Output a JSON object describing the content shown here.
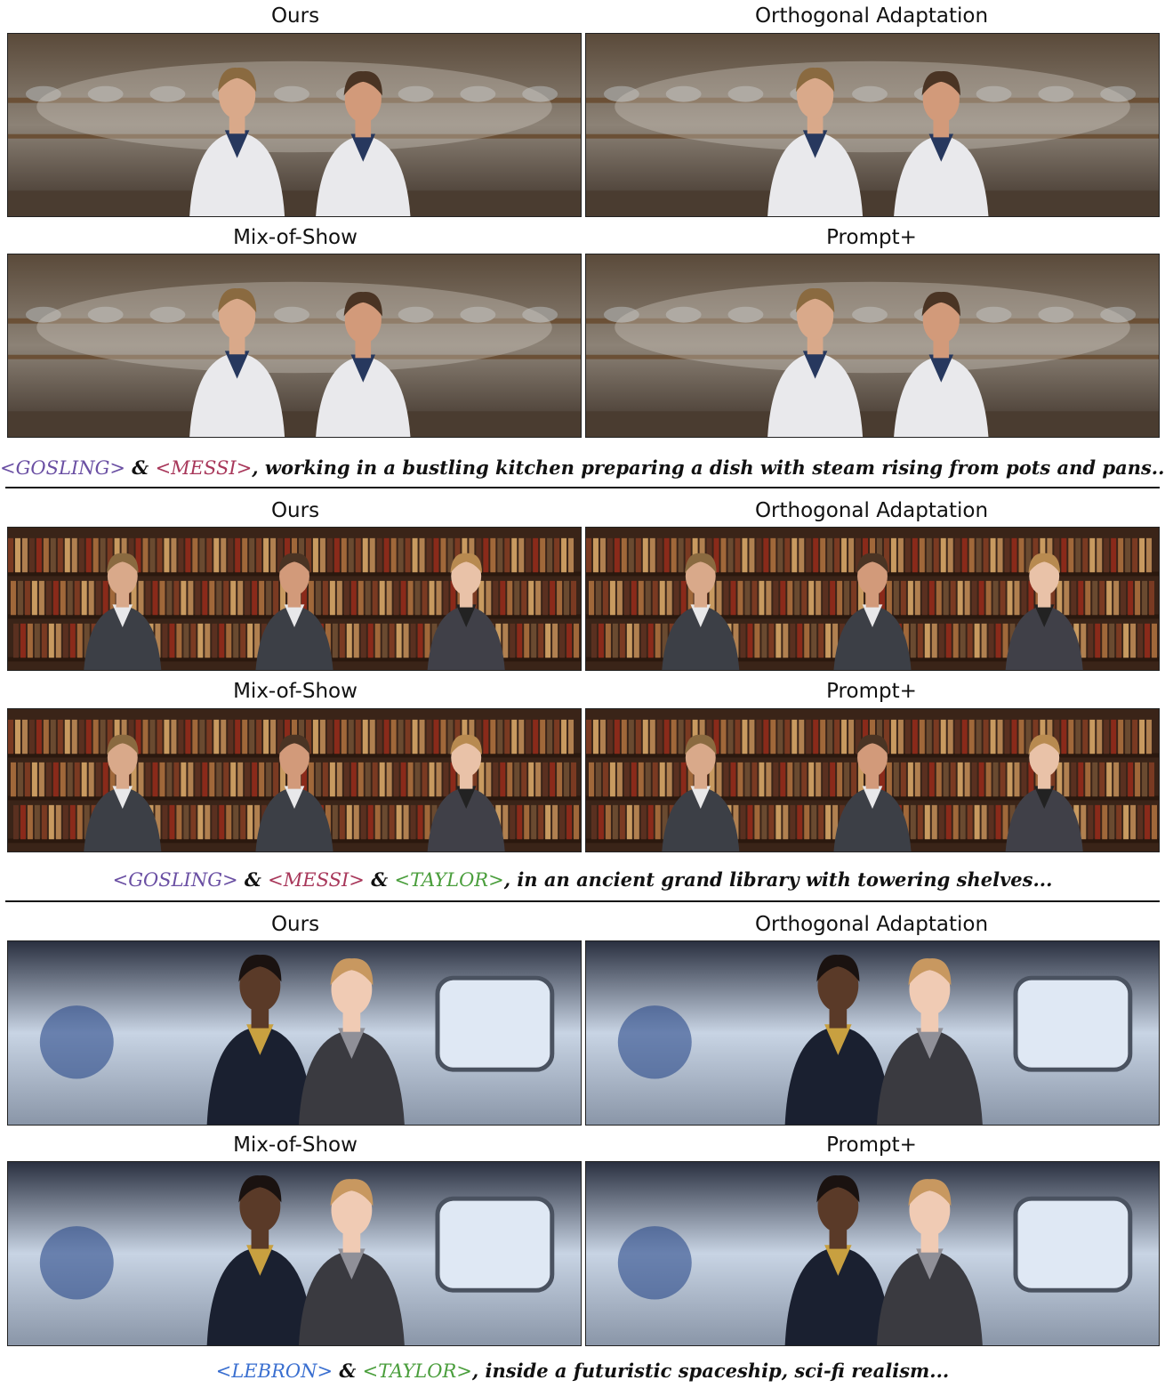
{
  "methods": [
    "Ours",
    "Orthogonal Adaptation",
    "Mix-of-Show",
    "Prompt+"
  ],
  "colors": {
    "gosling": "#6a4fa3",
    "messi": "#a8375a",
    "taylor": "#4a9e3c",
    "lebron": "#3a6fd0",
    "text": "#111111"
  },
  "groups": [
    {
      "scene": "kitchen",
      "caption": {
        "parts": [
          {
            "text": "<GOSLING>",
            "color": "gosling"
          },
          {
            "text": " & ",
            "color": "text"
          },
          {
            "text": "<MESSI>",
            "color": "messi"
          },
          {
            "text": ", working in a bustling kitchen preparing a dish with steam rising from pots and pans...",
            "color": "text"
          }
        ]
      }
    },
    {
      "scene": "library",
      "caption": {
        "parts": [
          {
            "text": "<GOSLING>",
            "color": "gosling"
          },
          {
            "text": " & ",
            "color": "text"
          },
          {
            "text": "<MESSI>",
            "color": "messi"
          },
          {
            "text": " & ",
            "color": "text"
          },
          {
            "text": "<TAYLOR>",
            "color": "taylor"
          },
          {
            "text": ",  in an ancient grand library with towering shelves...",
            "color": "text"
          }
        ]
      }
    },
    {
      "scene": "spaceship",
      "caption": {
        "parts": [
          {
            "text": "<LEBRON>",
            "color": "lebron"
          },
          {
            "text": " & ",
            "color": "text"
          },
          {
            "text": "<TAYLOR>",
            "color": "taylor"
          },
          {
            "text": ", inside a futuristic spaceship, sci-fi realism...",
            "color": "text"
          }
        ]
      }
    }
  ]
}
